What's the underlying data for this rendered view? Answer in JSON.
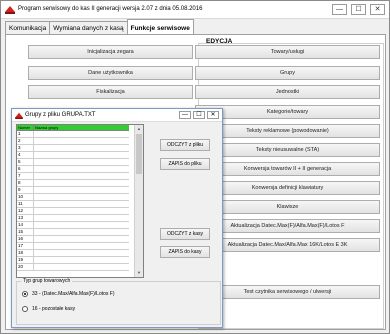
{
  "window": {
    "title": "Program serwisowy do kas II generacji wersja 2.07 z dnia 05.08.2016",
    "minimize": "—",
    "maximize": "☐",
    "close": "✕"
  },
  "tabs": [
    {
      "label": "Komunikacja"
    },
    {
      "label": "Wymiana danych z kasą"
    },
    {
      "label": "Funkcje serwisowe"
    }
  ],
  "left_buttons": [
    "Inicjalizacja zegara",
    "Dane użytkownika",
    "Fiskalizacja"
  ],
  "edycja": {
    "label": "EDYCJA",
    "buttons": [
      "Towary/usługi",
      "Grupy",
      "Jednostki",
      "Kategorie/towary",
      "Teksty reklamowe (powodowanie)",
      "Teksty nieusuwalne (STA)",
      "Konwersja towarów II + II generacja",
      "Konwersja definicji klawiatury",
      "Klawisze",
      "Aktualizacja Datec.Max(F)/Alfa.Max(F)/Lotos F",
      "Aktualizacja Datec.Max/Alfa.Max 16K/Lotos E 3K",
      "Test czytnika serwisowego / ulwersji"
    ]
  },
  "dialog": {
    "title": "Grupy z pliku GRUPA.TXT",
    "minimize": "—",
    "maximize": "☐",
    "close": "✕",
    "grid_headers": [
      "Numer",
      "Nazwa grupy"
    ],
    "row_numbers": [
      "1",
      "2",
      "3",
      "4",
      "5",
      "6",
      "7",
      "8",
      "9",
      "10",
      "11",
      "12",
      "13",
      "14",
      "15",
      "16",
      "17",
      "18",
      "19",
      "20"
    ],
    "buttons": {
      "read_file": "ODCZYT z pliku",
      "save_file": "ZAPIS do pliku",
      "read_register": "ODCZYT z kasy",
      "save_register": "ZAPIS do kasy"
    },
    "group_type": {
      "legend": "Typ grup towarowych",
      "options": [
        {
          "label": "33 - (Datec.Max/Alfa.Max(F)/Lotos F)",
          "selected": true
        },
        {
          "label": "16 - pozostałe kasy",
          "selected": false
        }
      ]
    }
  }
}
